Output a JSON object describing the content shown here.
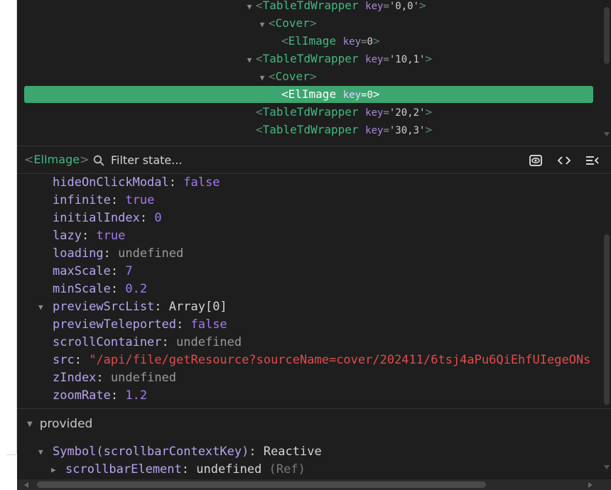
{
  "component_tree": {
    "rows": [
      {
        "tag": "TableTdWrapper",
        "attr": "key",
        "value": "'0,0'",
        "expanded": true
      },
      {
        "tag": "Cover",
        "expanded": true
      },
      {
        "tag": "ElImage",
        "attr": "key",
        "value": "0"
      },
      {
        "tag": "TableTdWrapper",
        "attr": "key",
        "value": "'10,1'",
        "expanded": true
      },
      {
        "tag": "Cover",
        "expanded": true
      },
      {
        "tag": "ElImage",
        "attr": "key",
        "value": "0",
        "selected": true
      },
      {
        "tag": "TableTdWrapper",
        "attr": "key",
        "value": "'20,2'"
      },
      {
        "tag": "TableTdWrapper",
        "attr": "key",
        "value": "'30,3'"
      }
    ]
  },
  "toolbar": {
    "component_name": "ElImage",
    "filter_placeholder": "Filter state...",
    "icons": [
      "eye-icon",
      "code-icon",
      "collapse-list-icon"
    ]
  },
  "state": {
    "props": [
      {
        "key": "hideOnClickModal",
        "value": "false",
        "type": "bool"
      },
      {
        "key": "infinite",
        "value": "true",
        "type": "bool"
      },
      {
        "key": "initialIndex",
        "value": "0",
        "type": "num"
      },
      {
        "key": "lazy",
        "value": "true",
        "type": "bool"
      },
      {
        "key": "loading",
        "value": "undefined",
        "type": "undef"
      },
      {
        "key": "maxScale",
        "value": "7",
        "type": "num"
      },
      {
        "key": "minScale",
        "value": "0.2",
        "type": "num"
      },
      {
        "key": "previewSrcList",
        "value": "Array[0]",
        "type": "obj",
        "expandable": true
      },
      {
        "key": "previewTeleported",
        "value": "false",
        "type": "bool"
      },
      {
        "key": "scrollContainer",
        "value": "undefined",
        "type": "undef"
      },
      {
        "key": "src",
        "value": "\"/api/file/getResource?sourceName=cover/202411/6tsj4aPu6QiEhfUIegeONs",
        "type": "str"
      },
      {
        "key": "zIndex",
        "value": "undefined",
        "type": "undef"
      },
      {
        "key": "zoomRate",
        "value": "1.2",
        "type": "num"
      }
    ],
    "provided_section": {
      "title": "provided",
      "symbol_key": "Symbol(scrollbarContextKey)",
      "symbol_value": "Reactive",
      "child_key": "scrollbarElement",
      "child_value": "undefined",
      "child_ref": "(Ref)"
    }
  },
  "colors": {
    "background": "#1e1e1e",
    "selected_row": "#3da56f",
    "tag": "#42b883",
    "key": "#b9a4f0",
    "string": "#e24c4c"
  }
}
